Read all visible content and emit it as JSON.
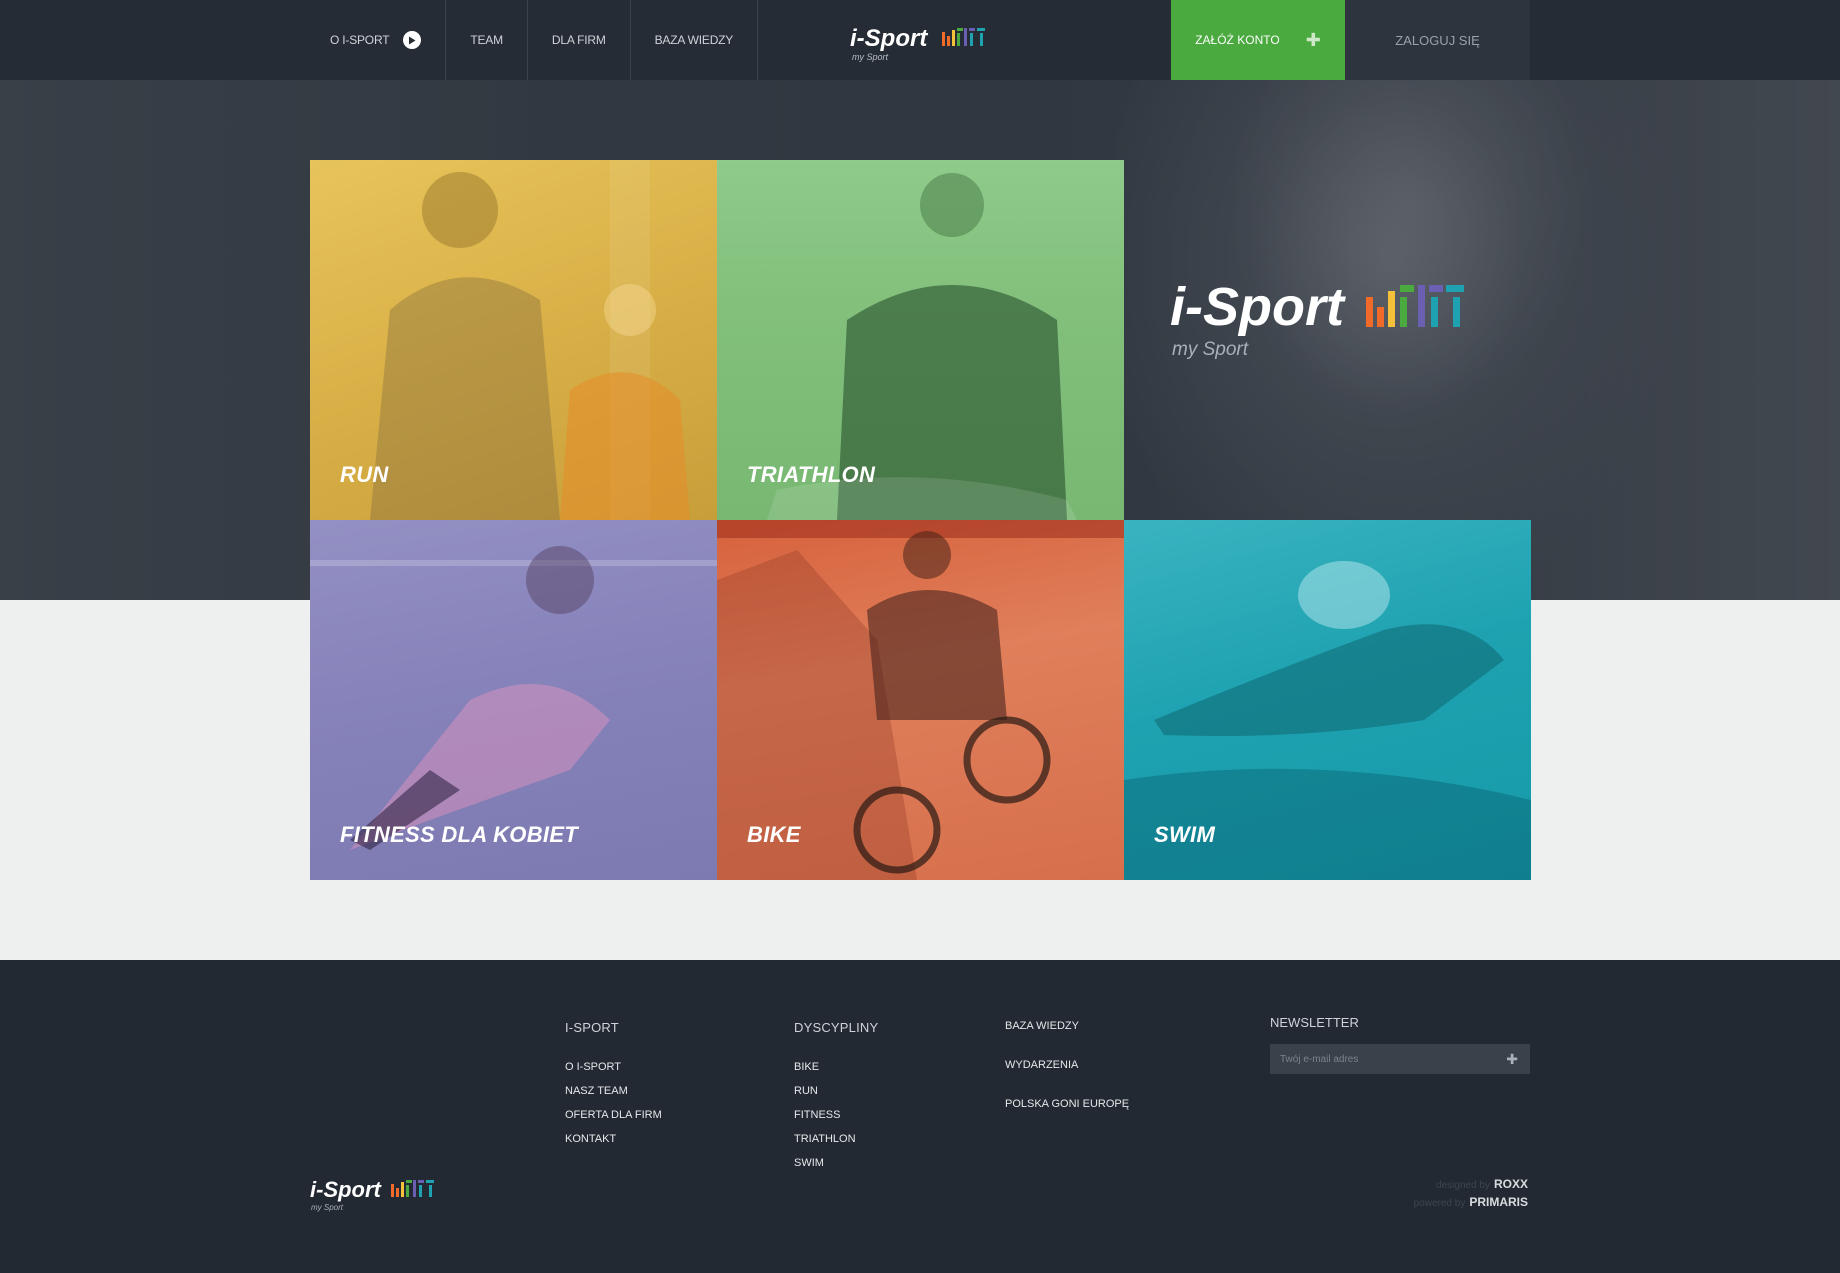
{
  "header": {
    "nav": [
      {
        "label": "O i-Sport"
      },
      {
        "label": "Team"
      },
      {
        "label": "Dla firm"
      },
      {
        "label": "Baza wiedzy"
      }
    ],
    "logo_text": "i-Sport",
    "logo_sub": "my Sport",
    "register_label": "Załóż konto",
    "login_label": "Zaloguj się"
  },
  "hero": {
    "logo_text": "i-Sport",
    "logo_sub": "my Sport"
  },
  "tiles": [
    {
      "label": "Run",
      "color": "#d9b047"
    },
    {
      "label": "Triathlon",
      "color": "#82c07c"
    },
    {
      "label": "Fitness dla kobiet",
      "color": "#8480b8"
    },
    {
      "label": "Bike",
      "color": "#e07f5b"
    },
    {
      "label": "Swim",
      "color": "#1ea2b1"
    }
  ],
  "footer": {
    "col1": {
      "title": "I-Sport",
      "links": [
        "O i-Sport",
        "Nasz team",
        "Oferta dla firm",
        "Kontakt"
      ]
    },
    "col2": {
      "title": "Dyscypliny",
      "links": [
        "Bike",
        "Run",
        "Fitness",
        "Triathlon",
        "Swim"
      ]
    },
    "col3": {
      "links": [
        "Baza wiedzy",
        "Wydarzenia",
        "Polska goni Europę"
      ]
    },
    "newsletter": {
      "title": "Newsletter",
      "placeholder": "Twój e-mail adres"
    },
    "logo_text": "i-Sport",
    "logo_sub": "my Sport",
    "designed_by_label": "designed by",
    "designed_by": "ROXX",
    "powered_by_label": "powered by",
    "powered_by": "PRIMARIS"
  },
  "colors": {
    "accent": "#4aaa3f",
    "dark": "#262c35"
  }
}
